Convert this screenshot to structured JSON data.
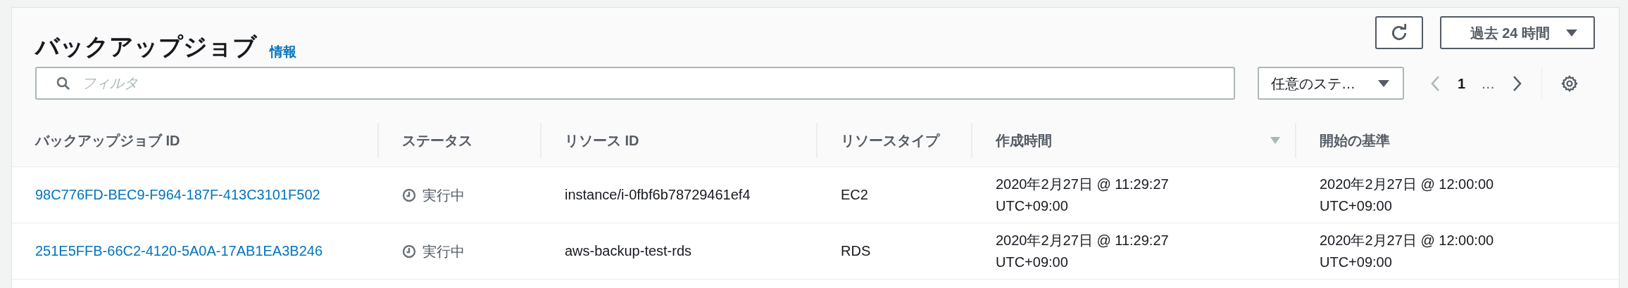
{
  "header": {
    "title": "バックアップジョブ",
    "info_link": "情報",
    "time_range": "過去 24 時間"
  },
  "filter": {
    "placeholder": "フィルタ"
  },
  "status_filter": {
    "value": "任意のステ…"
  },
  "pagination": {
    "previous_disabled": true,
    "next_disabled": false,
    "pages": [
      {
        "label": "1",
        "selected": true
      },
      {
        "label": "…",
        "selected": false
      }
    ]
  },
  "table": {
    "columns": [
      {
        "label": "バックアップジョブ ID",
        "sorted": false
      },
      {
        "label": "ステータス",
        "sorted": false
      },
      {
        "label": "リソース ID",
        "sorted": false
      },
      {
        "label": "リソースタイプ",
        "sorted": false
      },
      {
        "label": "作成時間",
        "sorted": true
      },
      {
        "label": "開始の基準",
        "sorted": false
      }
    ],
    "rows": [
      {
        "job_id": "98C776FD-BEC9-F964-187F-413C3101F502",
        "status": {
          "kind": "running",
          "label": "実行中"
        },
        "resource_id": "instance/i-0fbf6b78729461ef4",
        "resource_type": "EC2",
        "created": "2020年2月27日 @ 11:29:27 UTC+09:00",
        "start_by": "2020年2月27日 @ 12:00:00 UTC+09:00"
      },
      {
        "job_id": "251E5FFB-66C2-4120-5A0A-17AB1EA3B246",
        "status": {
          "kind": "running",
          "label": "実行中"
        },
        "resource_id": "aws-backup-test-rds",
        "resource_type": "RDS",
        "created": "2020年2月27日 @ 11:29:27 UTC+09:00",
        "start_by": "2020年2月27日 @ 12:00:00 UTC+09:00"
      }
    ]
  }
}
